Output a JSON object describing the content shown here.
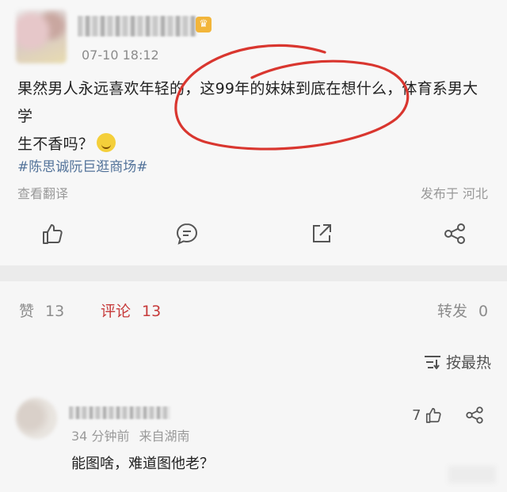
{
  "post": {
    "time": "07-10 18:12",
    "content_line1": "果然男人永远喜欢年轻的，这99年的妹妹到底在想什么，体育系男大学",
    "content_line2": "生不香吗？",
    "emoji_icon": "crying-face-icon",
    "hashtag": "#陈思诚阮巨逛商场#",
    "translate": "查看翻译",
    "location": "发布于 河北",
    "actions": [
      "like-icon",
      "comment-icon",
      "forward-icon",
      "share-icon"
    ]
  },
  "stats": {
    "likes_label": "赞",
    "likes_count": "13",
    "comments_label": "评论",
    "comments_count": "13",
    "reposts_label": "转发",
    "reposts_count": "0",
    "sort_label": "按最热"
  },
  "comment": {
    "minutes_ago": "34 分钟前",
    "source": "来自湖南",
    "text": "能图啥，难道图他老？",
    "like_count": "7"
  },
  "colors": {
    "accent_red": "#c63a3a",
    "hashtag_blue": "#53739a",
    "annotation_circle": "#d9362f"
  }
}
